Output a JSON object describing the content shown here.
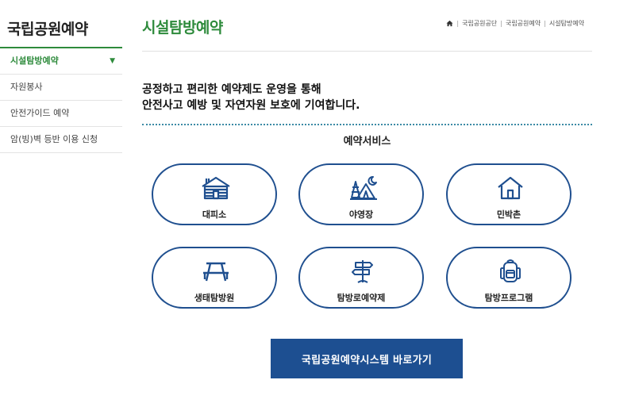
{
  "sidebar": {
    "title": "국립공원예약",
    "items": [
      {
        "label": "시설탐방예약"
      },
      {
        "label": "자원봉사"
      },
      {
        "label": "안전가이드 예약"
      },
      {
        "label": "암(빙)벽 등반 이용 신청"
      }
    ]
  },
  "header": {
    "title": "시설탐방예약",
    "breadcrumb": [
      "국립공원공단",
      "국립공원예약",
      "시설탐방예약"
    ]
  },
  "intro": {
    "line1": "공정하고 편리한 예약제도 운영을 통해",
    "line2": "안전사고 예방 및 자연자원 보호에 기여합니다."
  },
  "services": {
    "title": "예약서비스",
    "items": [
      {
        "label": "대피소",
        "icon": "cabin-icon"
      },
      {
        "label": "야영장",
        "icon": "tent-icon"
      },
      {
        "label": "민박촌",
        "icon": "house-icon"
      },
      {
        "label": "생태탐방원",
        "icon": "picnic-table-icon"
      },
      {
        "label": "탐방로예약제",
        "icon": "signpost-icon"
      },
      {
        "label": "탐방프로그램",
        "icon": "backpack-icon"
      }
    ]
  },
  "cta": {
    "label": "국립공원예약시스템 바로가기"
  },
  "colors": {
    "green": "#2e8b3c",
    "navy": "#1d4f91",
    "border": "#1f4f8f",
    "dotted": "#3b8aa5"
  }
}
